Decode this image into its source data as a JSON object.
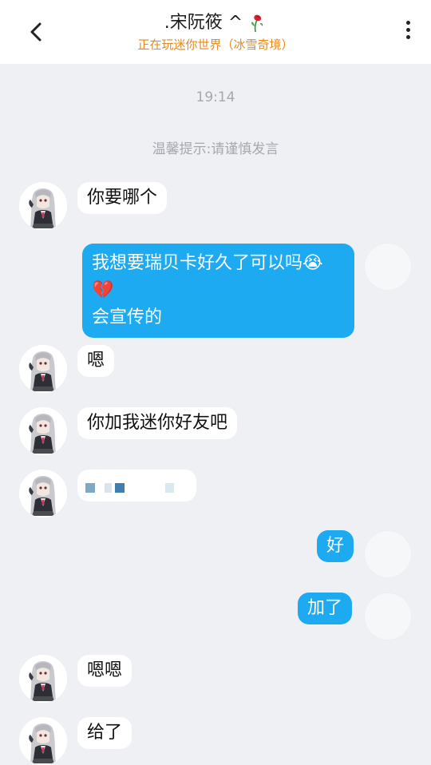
{
  "header": {
    "title": ".宋阮筱 ^",
    "subtitle": "正在玩迷你世界（冰雪奇境）"
  },
  "chat": {
    "time": "19:14",
    "notice": "温馨提示:请谨慎发言",
    "messages": [
      {
        "side": "left",
        "text": "你要哪个"
      },
      {
        "side": "right",
        "line1": "我想要瑞贝卡好久了可以吗😭",
        "line2": "💔",
        "line3": "会宣传的"
      },
      {
        "side": "left",
        "text": "嗯"
      },
      {
        "side": "left",
        "text": "你加我迷你好友吧"
      },
      {
        "side": "left",
        "text": ""
      },
      {
        "side": "right",
        "text": "好"
      },
      {
        "side": "right",
        "text": "加了"
      },
      {
        "side": "left",
        "text": "嗯嗯"
      },
      {
        "side": "left",
        "text": "给了"
      }
    ]
  },
  "icons": {
    "back": "chevron-left-icon",
    "more": "more-vertical-icon",
    "title_decoration": "rose-icon",
    "contact_avatar": "anime-girl-avatar",
    "self_avatar": "blank-avatar"
  },
  "colors": {
    "accent_bubble": "#1eaaf1",
    "subtitle": "#e58a1b",
    "background": "#eef0f4"
  }
}
